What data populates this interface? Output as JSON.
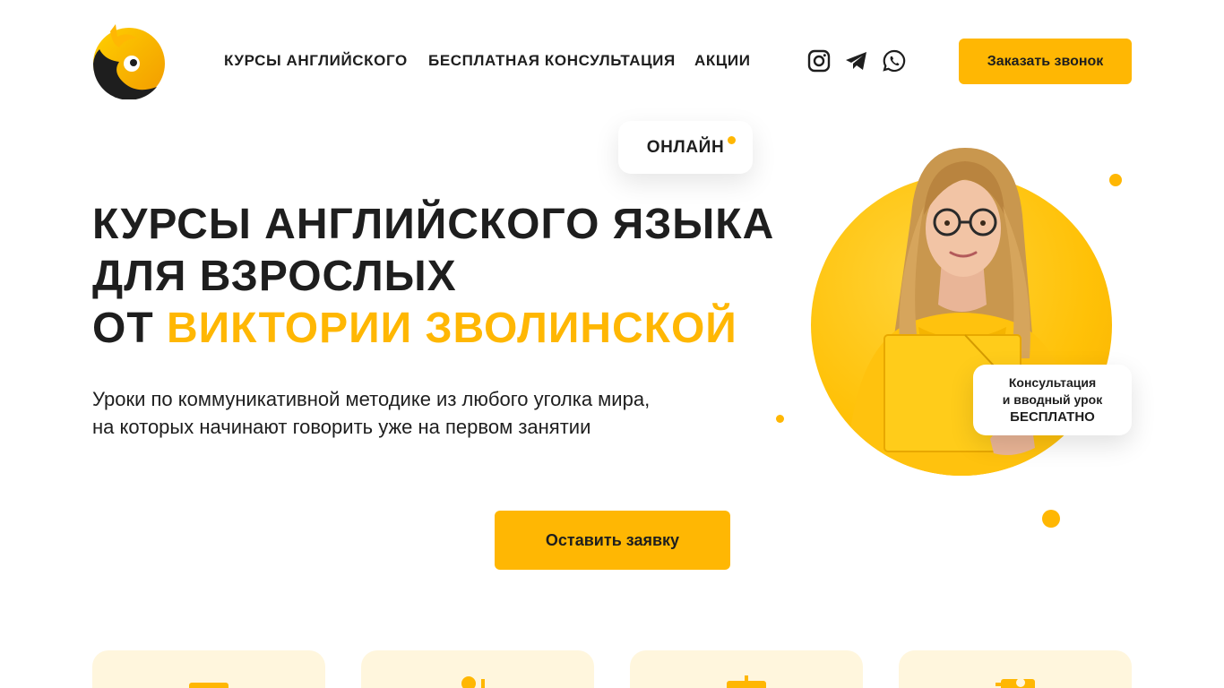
{
  "header": {
    "nav": [
      {
        "label": "КУРСЫ АНГЛИЙСКОГО"
      },
      {
        "label": "БЕСПЛАТНАЯ КОНСУЛЬТАЦИЯ"
      },
      {
        "label": "АКЦИИ"
      }
    ],
    "social_icons": [
      "instagram-icon",
      "telegram-icon",
      "whatsapp-icon"
    ],
    "call_button": "Заказать звонок"
  },
  "hero": {
    "online_badge": "ОНЛАЙН",
    "title_line1": "КУРСЫ АНГЛИЙСКОГО ЯЗЫКА",
    "title_line2": "ДЛЯ ВЗРОСЛЫХ",
    "title_line3_prefix": "ОТ ",
    "title_line3_accent": "ВИКТОРИИ ЗВОЛИНСКОЙ",
    "subtitle_line1": "Уроки по коммуникативной методике из любого уголка мира,",
    "subtitle_line2": "на которых начинают говорить уже на первом занятии",
    "cta_button": "Оставить заявку",
    "consult_badge": {
      "line1": "Консультация",
      "line2": "и вводный урок",
      "line3": "БЕСПЛАТНО"
    }
  },
  "colors": {
    "accent": "#ffb703",
    "text": "#1e1e1e",
    "card_bg": "#fff6dd"
  }
}
